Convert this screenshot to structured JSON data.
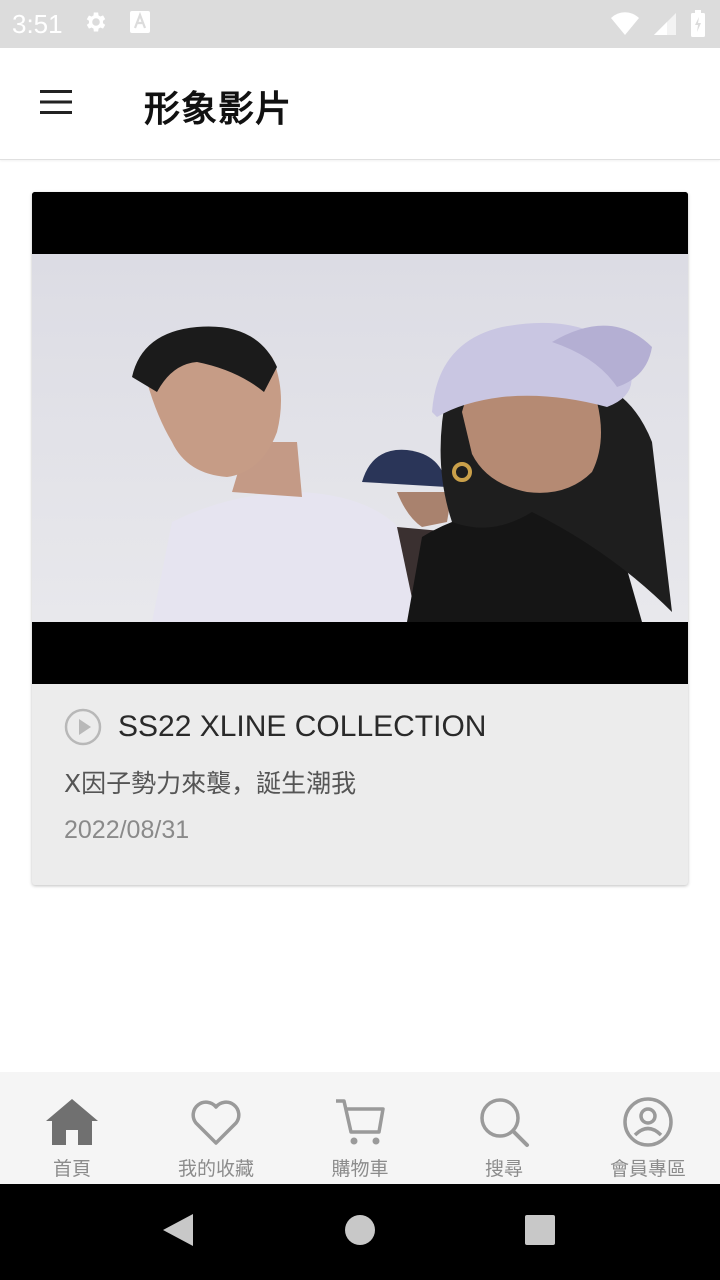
{
  "status_bar": {
    "time": "3:51",
    "icons": [
      "settings-icon",
      "a-icon",
      "wifi-icon",
      "signal-icon",
      "battery-icon"
    ]
  },
  "app_bar": {
    "title": "形象影片",
    "menu_icon": "hamburger-menu-icon"
  },
  "videos": [
    {
      "title": "SS22 XLINE COLLECTION",
      "subtitle": "X因子勢力來襲，誕生潮我",
      "date": "2022/08/31",
      "icon": "play-circle-icon"
    }
  ],
  "bottom_nav": {
    "items": [
      {
        "label": "首頁",
        "icon": "home-icon",
        "active": true
      },
      {
        "label": "我的收藏",
        "icon": "heart-icon",
        "active": false
      },
      {
        "label": "購物車",
        "icon": "cart-icon",
        "active": false
      },
      {
        "label": "搜尋",
        "icon": "search-icon",
        "active": false
      },
      {
        "label": "會員專區",
        "icon": "account-icon",
        "active": false
      }
    ]
  },
  "colors": {
    "status_bar_bg": "#dcdcdc",
    "card_bg": "#ececec",
    "nav_bg": "#f5f5f5",
    "nav_active_icon": "#707070",
    "nav_inactive_icon": "#9a9a9a"
  }
}
